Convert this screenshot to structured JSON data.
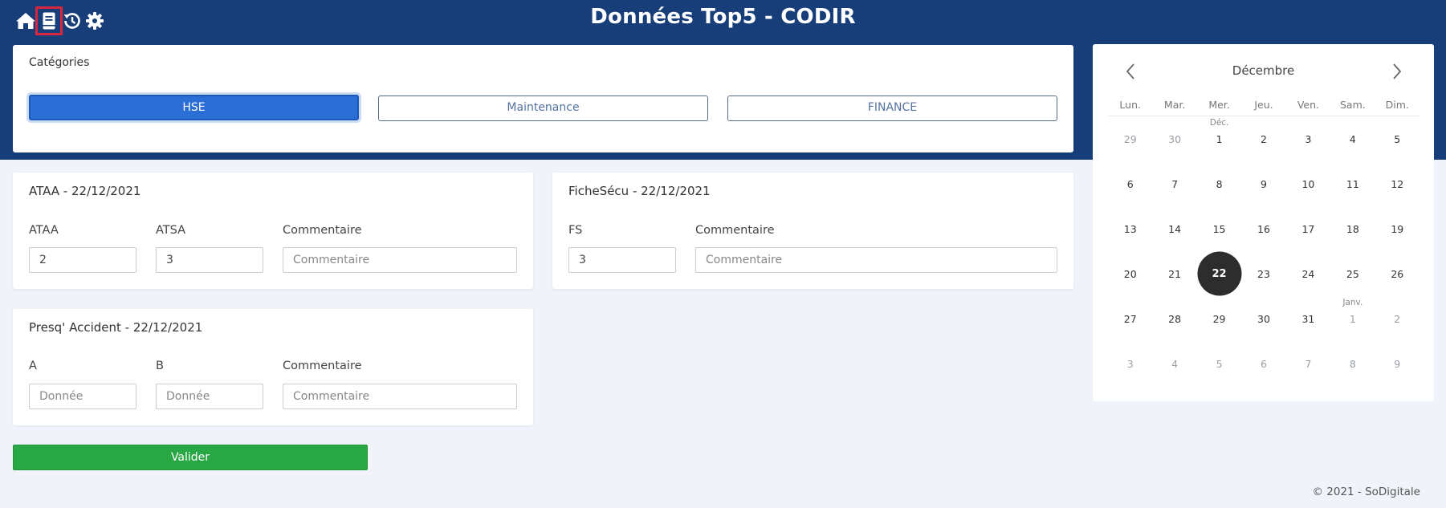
{
  "header": {
    "title": "Données Top5 - CODIR",
    "icons": [
      "home-icon",
      "book-icon",
      "history-icon",
      "gear-icon"
    ],
    "active_icon": "book-icon"
  },
  "categories": {
    "title": "Catégories",
    "buttons": [
      {
        "label": "HSE",
        "selected": true
      },
      {
        "label": "Maintenance",
        "selected": false
      },
      {
        "label": "FINANCE",
        "selected": false
      }
    ]
  },
  "ataa": {
    "title": "ATAA - 22/12/2021",
    "fields": [
      {
        "label": "ATAA",
        "value": "2",
        "placeholder": ""
      },
      {
        "label": "ATSA",
        "value": "3",
        "placeholder": ""
      },
      {
        "label": "Commentaire",
        "value": "",
        "placeholder": "Commentaire"
      }
    ]
  },
  "fichesecu": {
    "title": "FicheSécu - 22/12/2021",
    "fields": [
      {
        "label": "FS",
        "value": "3",
        "placeholder": ""
      },
      {
        "label": "Commentaire",
        "value": "",
        "placeholder": "Commentaire"
      }
    ]
  },
  "presq": {
    "title": "Presq' Accident - 22/12/2021",
    "fields": [
      {
        "label": "A",
        "value": "",
        "placeholder": "Donnée"
      },
      {
        "label": "B",
        "value": "",
        "placeholder": "Donnée"
      },
      {
        "label": "Commentaire",
        "value": "",
        "placeholder": "Commentaire"
      }
    ]
  },
  "validate_label": "Valider",
  "footer": "© 2021 - SoDigitale",
  "calendar": {
    "month": "Décembre",
    "weekdays": [
      "Lun.",
      "Mar.",
      "Mer.",
      "Jeu.",
      "Ven.",
      "Sam.",
      "Dim."
    ],
    "weeks": [
      [
        {
          "d": "29",
          "muted": true
        },
        {
          "d": "30",
          "muted": true
        },
        {
          "d": "1",
          "label": "Déc."
        },
        {
          "d": "2"
        },
        {
          "d": "3"
        },
        {
          "d": "4"
        },
        {
          "d": "5"
        }
      ],
      [
        {
          "d": "6"
        },
        {
          "d": "7"
        },
        {
          "d": "8"
        },
        {
          "d": "9"
        },
        {
          "d": "10"
        },
        {
          "d": "11"
        },
        {
          "d": "12"
        }
      ],
      [
        {
          "d": "13"
        },
        {
          "d": "14"
        },
        {
          "d": "15"
        },
        {
          "d": "16"
        },
        {
          "d": "17"
        },
        {
          "d": "18"
        },
        {
          "d": "19"
        }
      ],
      [
        {
          "d": "20"
        },
        {
          "d": "21"
        },
        {
          "d": "22",
          "selected": true
        },
        {
          "d": "23"
        },
        {
          "d": "24"
        },
        {
          "d": "25"
        },
        {
          "d": "26"
        }
      ],
      [
        {
          "d": "27"
        },
        {
          "d": "28"
        },
        {
          "d": "29"
        },
        {
          "d": "30"
        },
        {
          "d": "31"
        },
        {
          "d": "1",
          "muted": true,
          "label": "Janv."
        },
        {
          "d": "2",
          "muted": true
        }
      ],
      [
        {
          "d": "3",
          "muted": true
        },
        {
          "d": "4",
          "muted": true
        },
        {
          "d": "5",
          "muted": true
        },
        {
          "d": "6",
          "muted": true
        },
        {
          "d": "7",
          "muted": true
        },
        {
          "d": "8",
          "muted": true
        },
        {
          "d": "9",
          "muted": true
        }
      ]
    ]
  },
  "colors": {
    "header_bg": "#173e78",
    "primary": "#2b6ed6",
    "success": "#28a745",
    "active_highlight": "#d7263d"
  }
}
